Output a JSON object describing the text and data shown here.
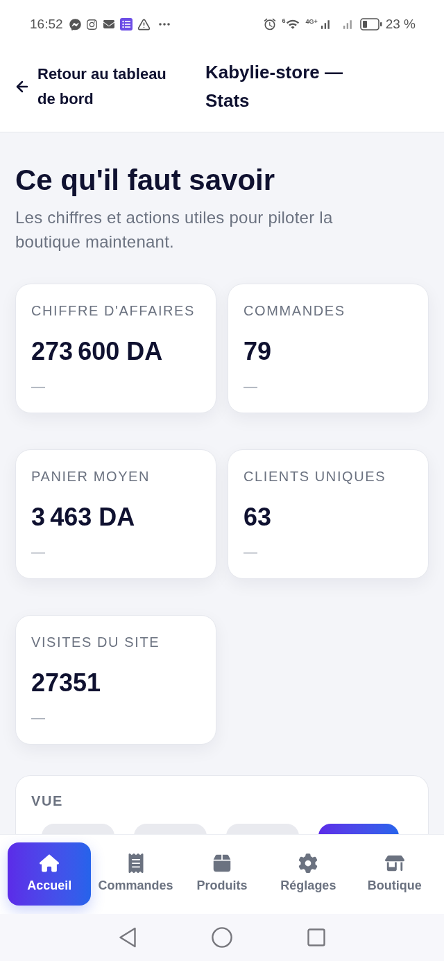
{
  "status_bar": {
    "time": "16:52",
    "wifi_band": "6",
    "network_type": "4G+",
    "battery": "23 %"
  },
  "header": {
    "back_link": "Retour au tableau de bord",
    "title": "Kabylie-store — Stats"
  },
  "intro": {
    "title": "Ce qu'il faut savoir",
    "subtitle": "Les chiffres et actions utiles pour piloter la boutique maintenant."
  },
  "stat_cards": [
    {
      "label": "CHIFFRE D'AFFAIRES",
      "value": "273 600 DA",
      "change": "—"
    },
    {
      "label": "COMMANDES",
      "value": "79",
      "change": "—"
    },
    {
      "label": "PANIER MOYEN",
      "value": "3 463 DA",
      "change": "—"
    },
    {
      "label": "CLIENTS UNIQUES",
      "value": "63",
      "change": "—"
    },
    {
      "label": "VISITES DU SITE",
      "value": "27351",
      "change": "—"
    }
  ],
  "view_panel": {
    "label": "VUE",
    "period_pills": [
      {
        "selected": false
      },
      {
        "selected": false
      },
      {
        "selected": false
      },
      {
        "selected": true
      }
    ]
  },
  "bottom_nav": [
    {
      "label": "Accueil",
      "selected": true
    },
    {
      "label": "Commandes",
      "selected": false
    },
    {
      "label": "Produits",
      "selected": false
    },
    {
      "label": "Réglages",
      "selected": false
    },
    {
      "label": "Boutique",
      "selected": false
    }
  ]
}
